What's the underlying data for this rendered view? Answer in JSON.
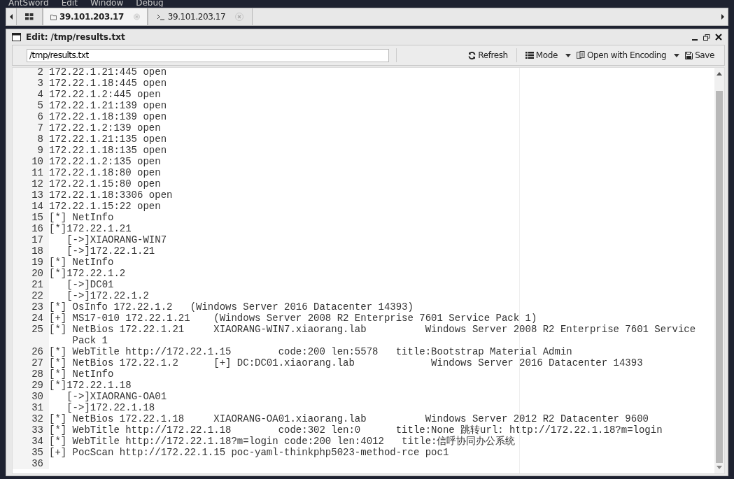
{
  "menu": [
    "AntSword",
    "Edit",
    "Window",
    "Debug"
  ],
  "tabs": [
    {
      "kind": "home",
      "selected": false
    },
    {
      "kind": "files",
      "label": "39.101.203.17",
      "selected": true
    },
    {
      "kind": "terminal",
      "label": "39.101.203.17",
      "selected": false
    }
  ],
  "panel": {
    "title": "Edit: /tmp/results.txt"
  },
  "toolbar": {
    "path": "/tmp/results.txt",
    "buttons": [
      {
        "kind": "refresh",
        "label": "Refresh"
      },
      {
        "kind": "mode",
        "label": "Mode"
      },
      {
        "kind": "encoding",
        "label": "Open with Encoding"
      },
      {
        "kind": "save",
        "label": "Save"
      }
    ]
  },
  "editor": {
    "lines": [
      {
        "n": "2",
        "text": "172.22.1.21:445 open"
      },
      {
        "n": "3",
        "text": "172.22.1.18:445 open"
      },
      {
        "n": "4",
        "text": "172.22.1.2:445 open"
      },
      {
        "n": "5",
        "text": "172.22.1.21:139 open"
      },
      {
        "n": "6",
        "text": "172.22.1.18:139 open"
      },
      {
        "n": "7",
        "text": "172.22.1.2:139 open"
      },
      {
        "n": "8",
        "text": "172.22.1.21:135 open"
      },
      {
        "n": "9",
        "text": "172.22.1.18:135 open"
      },
      {
        "n": "10",
        "text": "172.22.1.2:135 open"
      },
      {
        "n": "11",
        "text": "172.22.1.18:80 open"
      },
      {
        "n": "12",
        "text": "172.22.1.15:80 open"
      },
      {
        "n": "13",
        "text": "172.22.1.18:3306 open"
      },
      {
        "n": "14",
        "text": "172.22.1.15:22 open"
      },
      {
        "n": "15",
        "text": "[*] NetInfo"
      },
      {
        "n": "16",
        "text": "[*]172.22.1.21"
      },
      {
        "n": "17",
        "text": "   [->]XIAORANG-WIN7"
      },
      {
        "n": "18",
        "text": "   [->]172.22.1.21"
      },
      {
        "n": "19",
        "text": "[*] NetInfo"
      },
      {
        "n": "20",
        "text": "[*]172.22.1.2"
      },
      {
        "n": "21",
        "text": "   [->]DC01"
      },
      {
        "n": "22",
        "text": "   [->]172.22.1.2"
      },
      {
        "n": "23",
        "text": "[*] OsInfo 172.22.1.2   (Windows Server 2016 Datacenter 14393)"
      },
      {
        "n": "24",
        "text": "[+] MS17-010 172.22.1.21    (Windows Server 2008 R2 Enterprise 7601 Service Pack 1)"
      },
      {
        "n": "25",
        "text": "[*] NetBios 172.22.1.21     XIAORANG-WIN7.xiaorang.lab          Windows Server 2008 R2 Enterprise 7601 Service Pack 1"
      },
      {
        "n": "26",
        "text": "[*] WebTitle http://172.22.1.15        code:200 len:5578   title:Bootstrap Material Admin"
      },
      {
        "n": "27",
        "text": "[*] NetBios 172.22.1.2      [+] DC:DC01.xiaorang.lab             Windows Server 2016 Datacenter 14393"
      },
      {
        "n": "28",
        "text": "[*] NetInfo"
      },
      {
        "n": "29",
        "text": "[*]172.22.1.18"
      },
      {
        "n": "30",
        "text": "   [->]XIAORANG-OA01"
      },
      {
        "n": "31",
        "text": "   [->]172.22.1.18"
      },
      {
        "n": "32",
        "text": "[*] NetBios 172.22.1.18     XIAORANG-OA01.xiaorang.lab          Windows Server 2012 R2 Datacenter 9600"
      },
      {
        "n": "33",
        "text": "[*] WebTitle http://172.22.1.18        code:302 len:0      title:None 跳转url: http://172.22.1.18?m=login"
      },
      {
        "n": "34",
        "text": "[*] WebTitle http://172.22.1.18?m=login code:200 len:4012   title:信呼协同办公系统"
      },
      {
        "n": "35",
        "text": "[+] PocScan http://172.22.1.15 poc-yaml-thinkphp5023-method-rce poc1"
      },
      {
        "n": "36"
      }
    ]
  }
}
